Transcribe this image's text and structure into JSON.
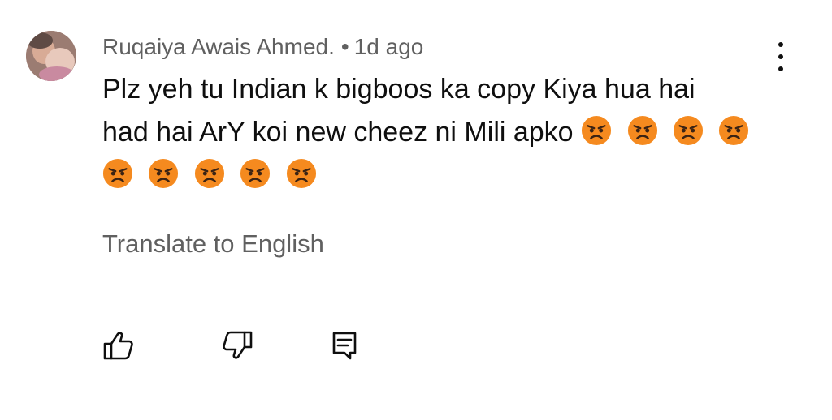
{
  "comment": {
    "author": "Ruqaiya Awais Ahmed.",
    "separator": "•",
    "time": "1d ago",
    "text_line1": "Plz yeh tu Indian k bigboos ka copy Kiya hua hai",
    "text_line2": "had hai ArY koi new cheez ni Mili apko",
    "emoji_line2": [
      "angry-face",
      "angry-face",
      "angry-face",
      "angry-face"
    ],
    "emoji_line3": [
      "angry-face",
      "angry-face",
      "angry-face",
      "angry-face",
      "angry-face"
    ],
    "translate_label": "Translate to English"
  },
  "actions": {
    "icons": [
      "thumbs-up-icon",
      "thumbs-down-icon",
      "reply-icon"
    ]
  },
  "colors": {
    "secondary_text": "#606060",
    "primary_text": "#0f0f0f",
    "emoji_face": "#f58a1f"
  }
}
